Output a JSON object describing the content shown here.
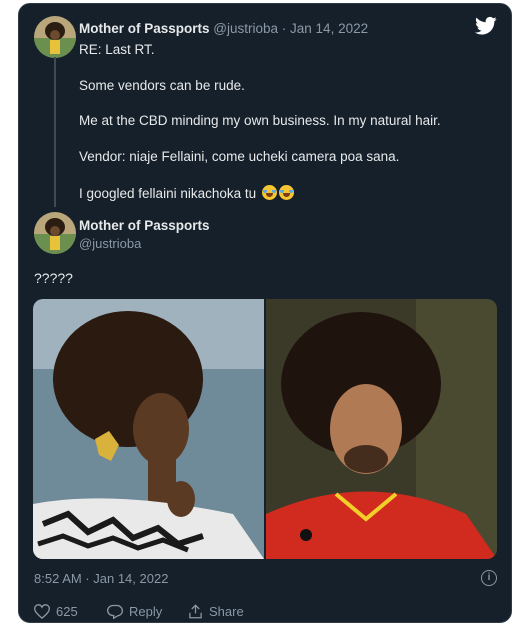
{
  "tweet": {
    "author_name": "Mother of Passports",
    "author_handle": "@justrioba",
    "separator": " · ",
    "date": "Jan 14, 2022",
    "lines": [
      "RE: Last RT.",
      "Some vendors can be rude.",
      "Me at the CBD minding my own business. In my natural hair.",
      "Vendor: niaje Fellaini, come ucheki camera poa sana.",
      "I googled fellaini nikachoka tu"
    ],
    "emoji": [
      "joy-emoji",
      "joy-emoji"
    ]
  },
  "reply": {
    "author_name": "Mother of Passports",
    "author_handle": "@justrioba",
    "text": "?????",
    "timestamp": "8:52 AM · Jan 14, 2022",
    "images": [
      "woman-afro-portrait",
      "footballer-afro-portrait"
    ]
  },
  "actions": {
    "like_count": "625",
    "reply_label": "Reply",
    "share_label": "Share"
  },
  "colors": {
    "background": "#15202b",
    "text": "#e7e9ea",
    "muted": "#8b98a5",
    "twitter_blue": "#ffffff"
  }
}
